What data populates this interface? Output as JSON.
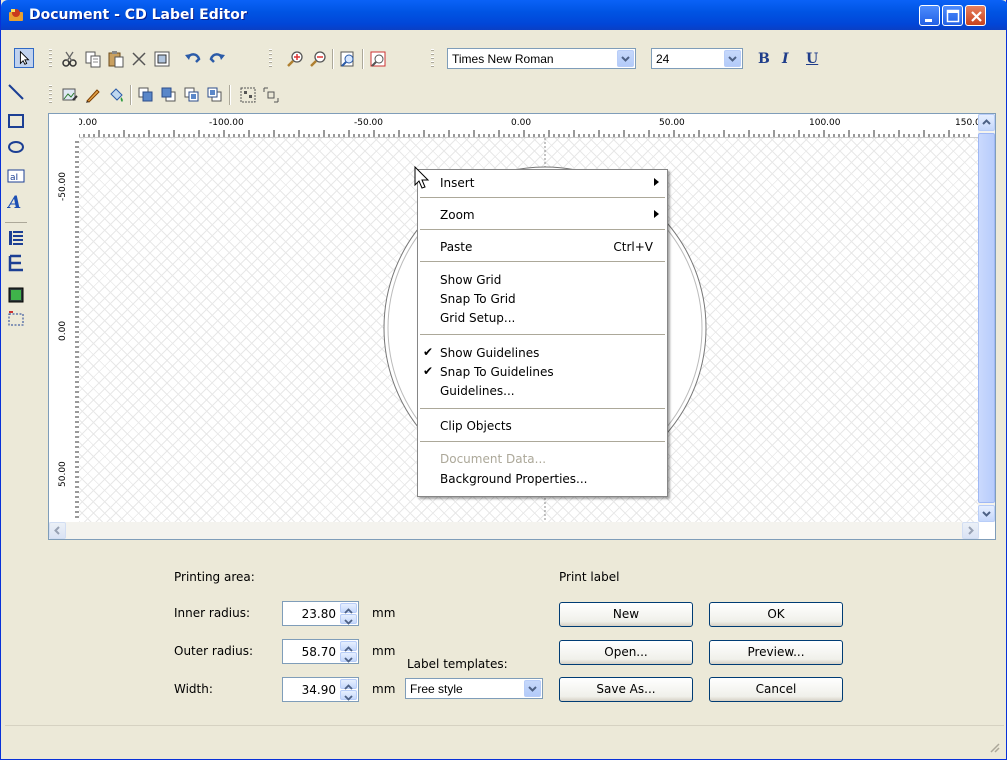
{
  "window": {
    "title": "Document - CD Label Editor"
  },
  "toolbar": {
    "font_name": "Times New Roman",
    "font_size": "24",
    "bold_label": "B",
    "italic_label": "I",
    "underline_label": "U"
  },
  "ruler": {
    "h_ticks": [
      "0.00",
      "-100.00",
      "-50.00",
      "0.00",
      "50.00",
      "100.00",
      "150.0"
    ],
    "v_ticks": [
      "-50.00",
      "0.00",
      "50.00"
    ]
  },
  "context_menu": {
    "items": [
      {
        "label": "Insert",
        "submenu": true
      },
      {
        "label": "Zoom",
        "submenu": true
      },
      {
        "label": "Paste",
        "shortcut": "Ctrl+V"
      },
      {
        "label": "Show Grid"
      },
      {
        "label": "Snap To Grid"
      },
      {
        "label": "Grid Setup..."
      },
      {
        "label": "Show Guidelines",
        "checked": true
      },
      {
        "label": "Snap To Guidelines",
        "checked": true
      },
      {
        "label": "Guidelines..."
      },
      {
        "label": "Clip Objects"
      },
      {
        "label": "Document Data...",
        "disabled": true
      },
      {
        "label": "Background Properties..."
      }
    ]
  },
  "printing_area": {
    "heading": "Printing area:",
    "inner_radius": {
      "label": "Inner radius:",
      "value": "23.80",
      "unit": "mm"
    },
    "outer_radius": {
      "label": "Outer radius:",
      "value": "58.70",
      "unit": "mm"
    },
    "width": {
      "label": "Width:",
      "value": "34.90",
      "unit": "mm"
    }
  },
  "label_templates": {
    "label": "Label templates:",
    "selected": "Free style"
  },
  "print_label": {
    "heading": "Print label",
    "new": "New",
    "open": "Open...",
    "save_as": "Save As...",
    "ok": "OK",
    "preview": "Preview...",
    "cancel": "Cancel"
  }
}
